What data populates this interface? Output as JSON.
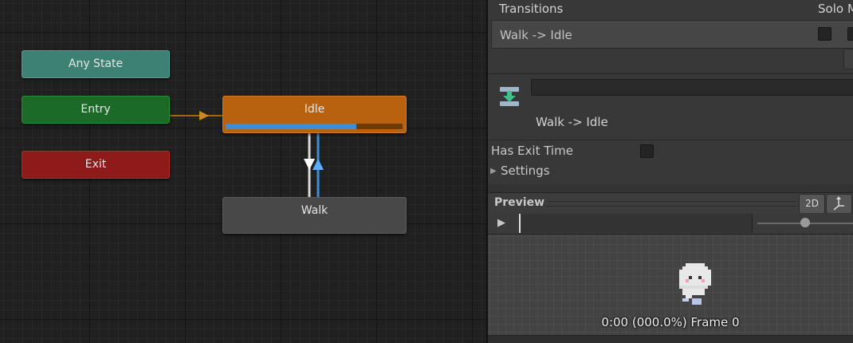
{
  "graph": {
    "states": {
      "any_state": "Any State",
      "entry": "Entry",
      "exit": "Exit",
      "idle": "Idle",
      "walk": "Walk"
    },
    "idle_progress": 0.74,
    "colors": {
      "any_state": "#3d8074",
      "entry": "#1b6a27",
      "exit": "#8f1a1a",
      "idle": "#b8620f",
      "walk": "#484848",
      "entry_transition": "#9a6a10",
      "selected_transition": "#3b8fd6"
    }
  },
  "inspector": {
    "transitions_header": "Transitions",
    "solo_header": "Solo",
    "mute_header": "M",
    "transition_row": "Walk -> Idle",
    "transition_title": "Walk -> Idle",
    "has_exit_time_label": "Has Exit Time",
    "settings_label": "Settings"
  },
  "preview": {
    "label": "Preview",
    "mode_2d": "2D",
    "frame_info": "0:00 (000.0%) Frame 0"
  }
}
